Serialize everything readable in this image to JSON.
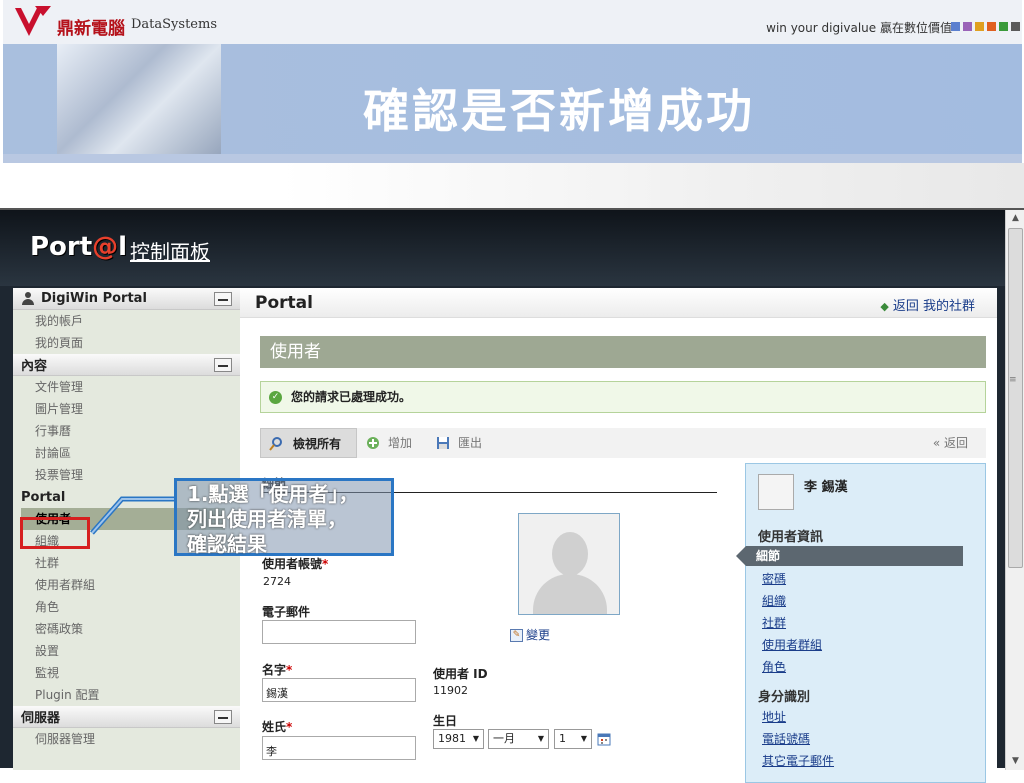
{
  "slide": {
    "company": "鼎新電腦",
    "company_en": "DataSystems",
    "slogan": "win your digivalue 贏在數位價值",
    "title": "確認是否新增成功",
    "square_colors": [
      "#5b7fcf",
      "#9a63b8",
      "#e0a020",
      "#e06020",
      "#3a9a3a",
      "#5a5a5a"
    ]
  },
  "app": {
    "logo": "Port@l",
    "control_panel": "控制面板"
  },
  "sidebar": {
    "sections": [
      {
        "title": "DigiWin Portal",
        "items": [
          "我的帳戶",
          "我的頁面"
        ]
      },
      {
        "title": "內容",
        "items": [
          "文件管理",
          "圖片管理",
          "行事曆",
          "討論區",
          "投票管理"
        ]
      },
      {
        "title": "Portal",
        "items": [
          "使用者",
          "組織",
          "社群",
          "使用者群組",
          "角色",
          "密碼政策",
          "設置",
          "監視",
          "Plugin 配置"
        ]
      },
      {
        "title": "伺服器",
        "items": [
          "伺服器管理"
        ]
      }
    ],
    "active_item": "使用者"
  },
  "main": {
    "title": "Portal",
    "back_link": "返回 我的社群",
    "section_title": "使用者",
    "success_msg": "您的請求已處理成功。",
    "toolbar": {
      "view_all": "檢視所有",
      "add": "增加",
      "export": "匯出",
      "back": "« 返回"
    },
    "form": {
      "details_label": "細節",
      "screen_name_label": "使用者帳號",
      "screen_name_value": "2724",
      "email_label": "電子郵件",
      "email_value": "",
      "first_name_label": "名字",
      "first_name_value": "錫漢",
      "last_name_label": "姓氏",
      "last_name_value": "李",
      "user_id_label": "使用者 ID",
      "user_id_value": "11902",
      "birthday_label": "生日",
      "birthday_year": "1981",
      "birthday_month": "一月",
      "birthday_day": "1",
      "change_link": "變更"
    }
  },
  "right_panel": {
    "name": "李 錫漢",
    "user_info_title": "使用者資訊",
    "active": "細節",
    "user_info_links": [
      "密碼",
      "組織",
      "社群",
      "使用者群組",
      "角色"
    ],
    "identity_title": "身分識別",
    "identity_links": [
      "地址",
      "電話號碼",
      "其它電子郵件"
    ]
  },
  "callout": {
    "line1": "1.點選「使用者」，",
    "line2": "列出使用者清單，",
    "line3": "確認結果"
  }
}
